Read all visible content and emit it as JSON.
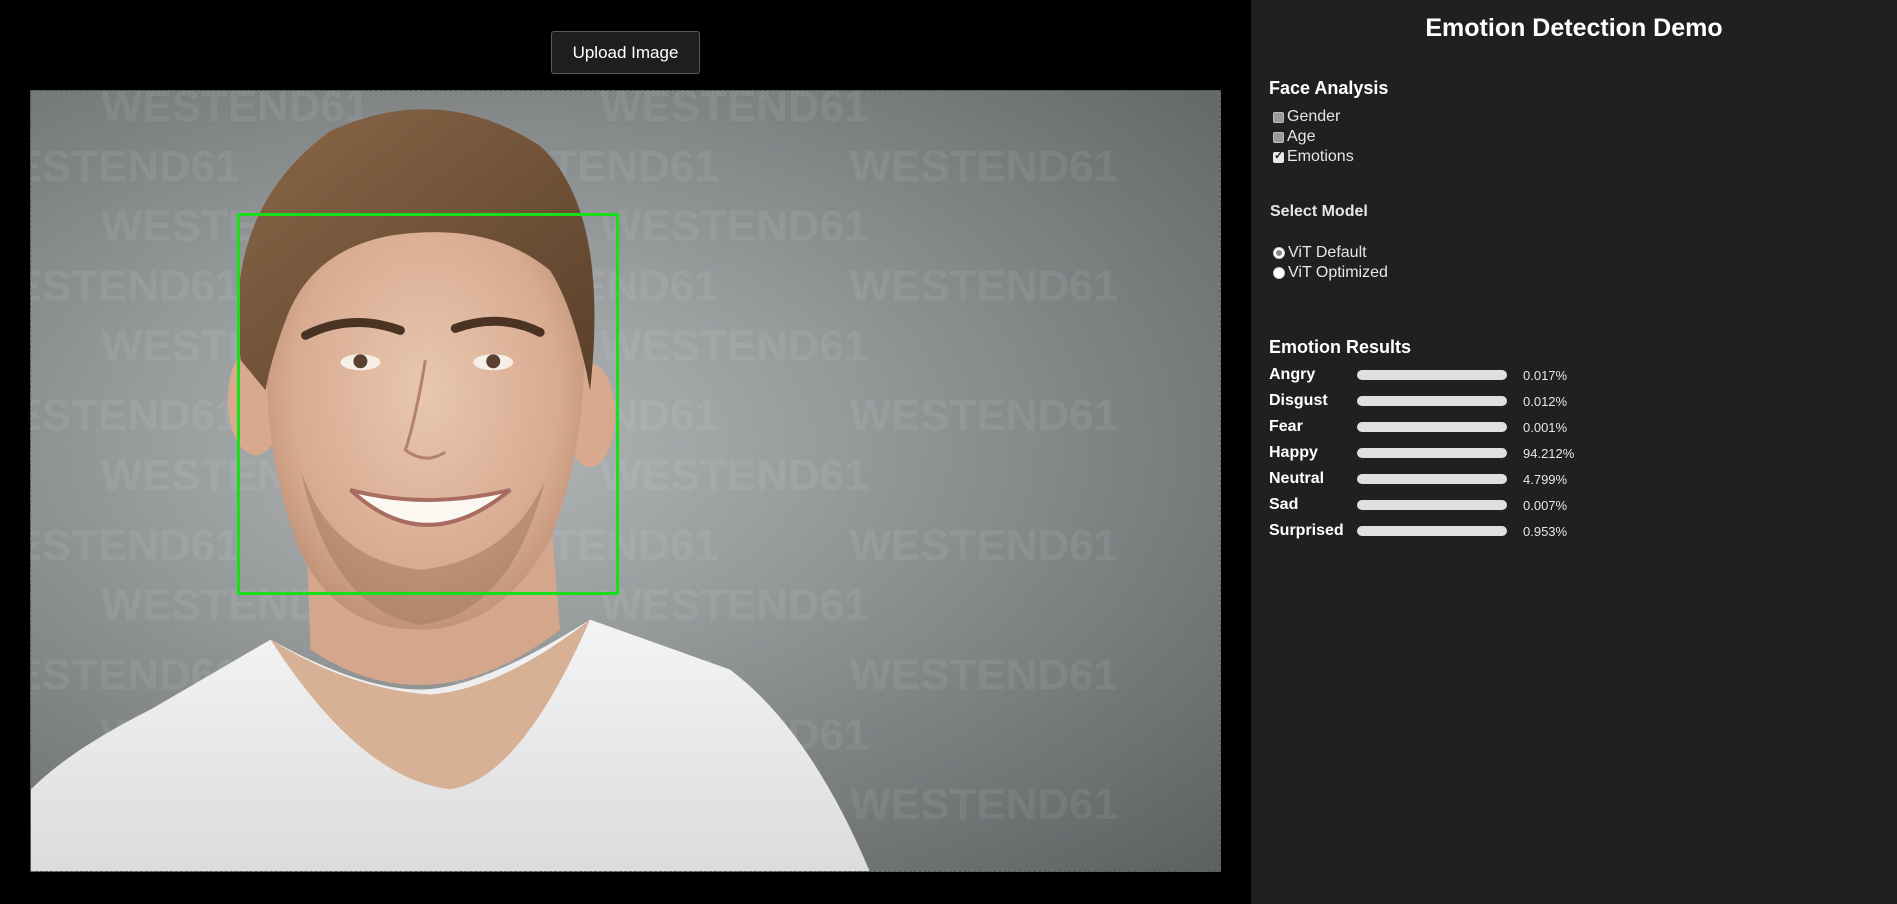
{
  "upload": {
    "label": "Upload Image"
  },
  "image": {
    "watermark_text": "WESTEND61",
    "face_box_color": "#18e018"
  },
  "panel": {
    "title": "Emotion Detection Demo",
    "face_analysis": {
      "heading": "Face Analysis",
      "options": [
        {
          "label": "Gender",
          "checked": false
        },
        {
          "label": "Age",
          "checked": false
        },
        {
          "label": "Emotions",
          "checked": true
        }
      ]
    },
    "model": {
      "heading": "Select Model",
      "options": [
        {
          "label": "ViT Default",
          "selected": true
        },
        {
          "label": "ViT Optimized",
          "selected": false
        }
      ]
    },
    "results": {
      "heading": "Emotion Results",
      "highlight_color": "#f0a84a",
      "base_fill_color": "#9a9a9a",
      "items": [
        {
          "label": "Angry",
          "value": 0.017,
          "text": "0.017%"
        },
        {
          "label": "Disgust",
          "value": 0.012,
          "text": "0.012%"
        },
        {
          "label": "Fear",
          "value": 0.001,
          "text": "0.001%"
        },
        {
          "label": "Happy",
          "value": 94.212,
          "text": "94.212%"
        },
        {
          "label": "Neutral",
          "value": 4.799,
          "text": "4.799%"
        },
        {
          "label": "Sad",
          "value": 0.007,
          "text": "0.007%"
        },
        {
          "label": "Surprised",
          "value": 0.953,
          "text": "0.953%"
        }
      ]
    }
  }
}
